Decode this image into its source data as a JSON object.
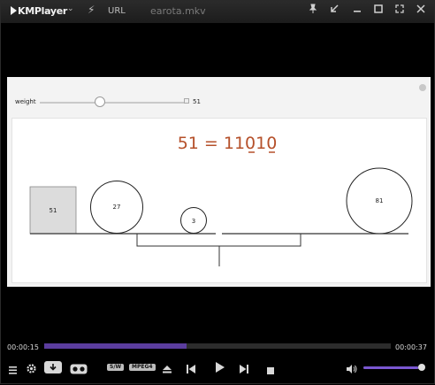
{
  "titlebar": {
    "brand": "KMPlayer",
    "url_label": "URL",
    "filename": "earota.mkv"
  },
  "applet": {
    "weight_label": "weight",
    "weight_value": "51",
    "weight_slider_fraction": 0.51,
    "equation": "51 = 11010",
    "blocks": {
      "square": "51",
      "circle_a": "27",
      "circle_b": "3",
      "circle_c": "81"
    }
  },
  "playback": {
    "elapsed": "00:00:15",
    "total": "00:00:37",
    "progress_fraction": 0.41,
    "volume_fraction": 0.92
  },
  "badges": {
    "sw": "S/W",
    "mpeg4": "MPEG4"
  },
  "colors": {
    "accent_purple": "#5b3d9e",
    "equation_color": "#b5502a"
  }
}
